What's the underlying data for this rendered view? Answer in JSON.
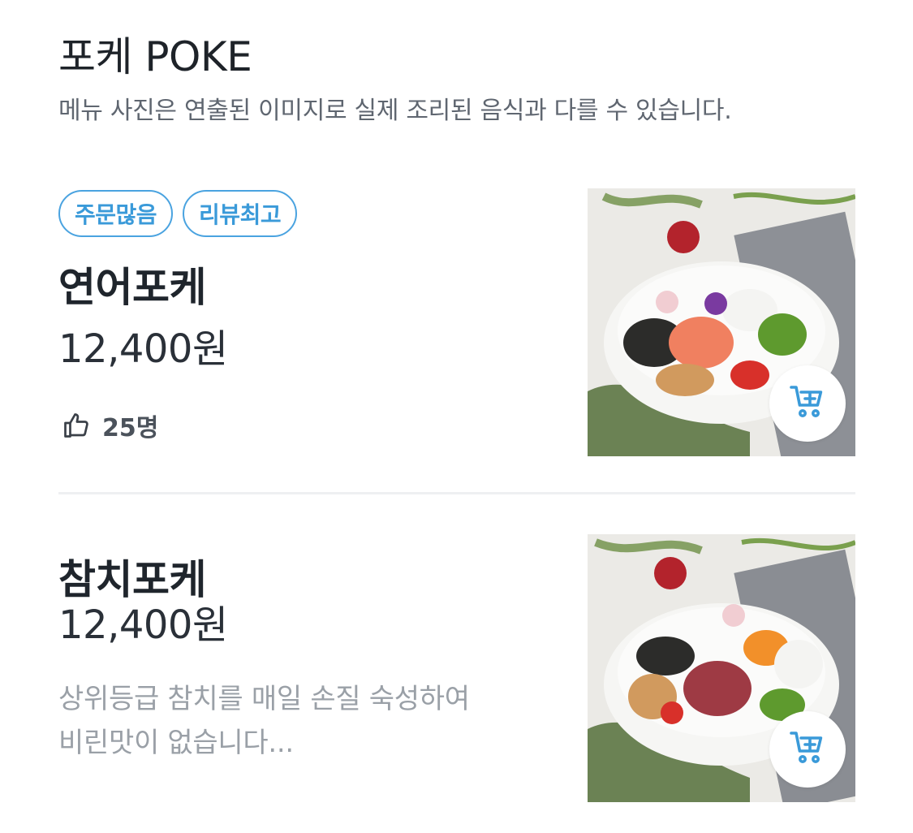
{
  "section": {
    "title": "포케 POKE",
    "note": "메뉴 사진은 연출된 이미지로 실제 조리된 음식과 다를 수 있습니다."
  },
  "items": [
    {
      "badges": [
        "주문많음",
        "리뷰최고"
      ],
      "name": "연어포케",
      "price": "12,400원",
      "likes": "25명",
      "image_icon": "poke-bowl-image",
      "cart_icon": "cart-add-icon"
    },
    {
      "name": "참치포케",
      "price": "12,400원",
      "description": "상위등급 참치를 매일 손질 숙성하여\n비린맛이 없습니다...",
      "image_icon": "poke-bowl-image",
      "cart_icon": "cart-add-icon"
    }
  ],
  "colors": {
    "accent": "#3a9ad9",
    "text": "#1f252c",
    "muted": "#9aa0a7",
    "divider": "#eef0f2"
  }
}
